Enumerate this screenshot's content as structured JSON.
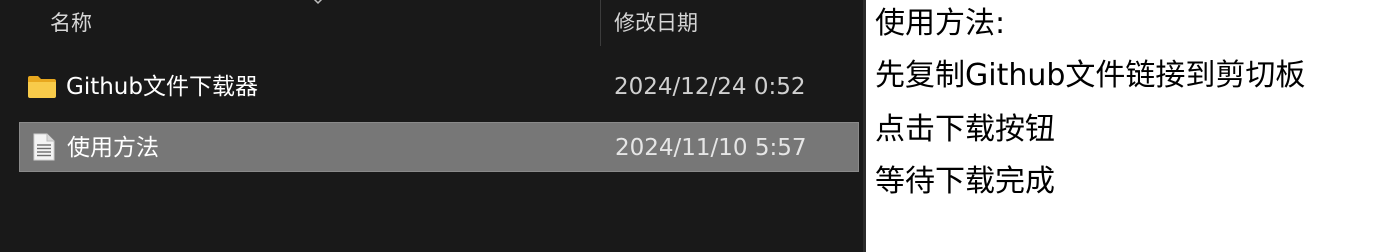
{
  "explorer": {
    "columns": {
      "name": "名称",
      "date_modified": "修改日期"
    },
    "files": [
      {
        "name": "Github文件下载器",
        "date": "2024/12/24 0:52",
        "icon": "folder-icon",
        "selected": false
      },
      {
        "name": "使用方法",
        "date": "2024/11/10 5:57",
        "icon": "text-file-icon",
        "selected": true
      }
    ]
  },
  "notes": {
    "lines": [
      "使用方法:",
      "先复制Github文件链接到剪切板",
      "点击下载按钮",
      "等待下载完成"
    ]
  },
  "colors": {
    "explorer_background": "#191919",
    "selection": "#777777",
    "folder": "#f6c445",
    "text": "#ffffff"
  }
}
